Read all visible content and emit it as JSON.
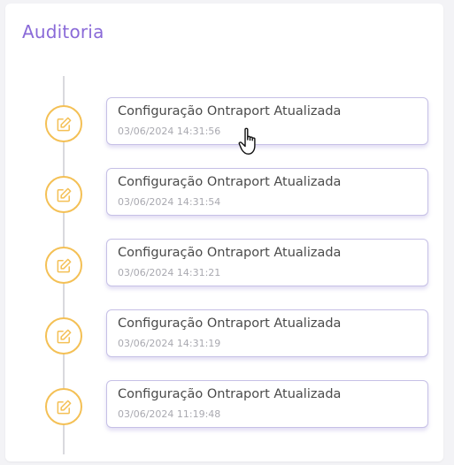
{
  "panel": {
    "title": "Auditoria"
  },
  "colors": {
    "title": "#8a6ad8",
    "icon_ring": "#f4c055",
    "card_border": "#c6c0e6"
  },
  "entries": [
    {
      "title": "Configuração Ontraport Atualizada",
      "date": "03/06/2024 14:31:56",
      "icon": "edit-icon"
    },
    {
      "title": "Configuração Ontraport Atualizada",
      "date": "03/06/2024 14:31:54",
      "icon": "edit-icon"
    },
    {
      "title": "Configuração Ontraport Atualizada",
      "date": "03/06/2024 14:31:21",
      "icon": "edit-icon"
    },
    {
      "title": "Configuração Ontraport Atualizada",
      "date": "03/06/2024 14:31:19",
      "icon": "edit-icon"
    },
    {
      "title": "Configuração Ontraport Atualizada",
      "date": "03/06/2024 11:19:48",
      "icon": "edit-icon"
    }
  ],
  "cursor": {
    "icon": "hand-pointer-icon"
  }
}
